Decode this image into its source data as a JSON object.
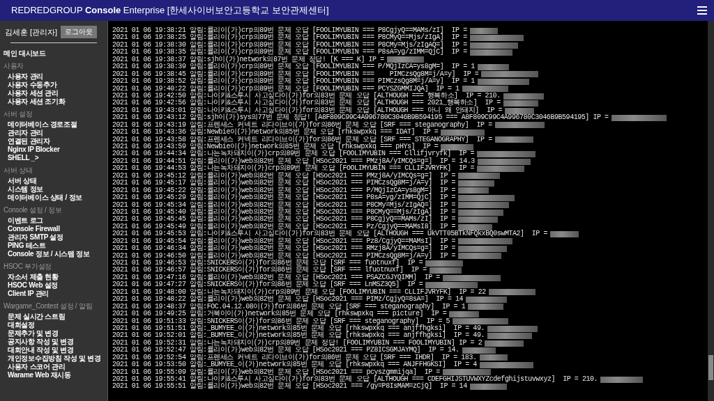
{
  "header": {
    "title": "REDREDGROUP **Console** Enterprise [한세사이버보안고등학교 보안관제센터]"
  },
  "sidebar": {
    "user": "김세훈 [관리자]",
    "logout": "로그아웃",
    "main_link": "메인 대시보드",
    "sections": [
      {
        "title": "사용자",
        "items": [
          "사용자 관리",
          "사용자 수동추가",
          "사용자 세션 관리",
          "사용자 세션 조기화"
        ]
      },
      {
        "title": "서버 설정",
        "items": [
          "데이터베이스 경로조절",
          "관리자 관리",
          "연결된 관리자",
          "Nginx IP Blocker",
          "SHELL _>"
        ]
      },
      {
        "title": "서버 상태",
        "items": [
          "서버 상태",
          "시스템 정보",
          "데이터베이스 상태 / 정보"
        ]
      },
      {
        "title": "Console 설정 / 정보",
        "items": [
          "이벤트 로그",
          "Console Firewall",
          "관리자 SMTP 설정",
          "PING 테스트",
          "Console 정보 / 시스템 정보"
        ]
      },
      {
        "title": "HSOC 부가설정",
        "items": [
          "자소서 제출 현황",
          "HSOC Web 설정",
          "Client IP 관리"
        ]
      },
      {
        "title": "Wargame_Contest 설정 / 알림",
        "items": [
          "문제 실시간 스트림",
          "대회설정",
          "문제추가 및 변경",
          "공지사항 작성 및 변경",
          "대회안내 작성 및 변경",
          "개인정보수집방침 작성 및 변경",
          "사용자 스코어 관리",
          "Warame Web 재시동"
        ]
      }
    ]
  },
  "log": {
    "lines": [
      "2021 01 06 19:38:21 알림:률리이(가)crp의89번 문제 오답 [FOOLIMYUBIN === P8CgjyQ==MAMs/zI]  IP =",
      "2021 01 06 19:38:25 알림:률리이(가)crp의89번 문제 오답 [FOOLIMYUBIN === P8CMyQ==Mjs/zIgA]  IP =",
      "2021 01 06 19:38:30 알림:률리이(가)crp의89번 문제 오답 [FOOLIMYUBIN === P8CMy=Mjs/zIgAQ=]  IP =",
      "2021 01 06 19:38:35 알림:률리이(가)crp의89번 문제 오답 [FOOLIMYUBIN === P8sA=yg/zIMM=QjC]  IP =",
      "2021 01 06 19:38:37 알림:sjh이(가)network의87번 문제 정답! [K === K] IP =",
      "2021 01 06 19:38:39 알림:률리이(가)crp의89번 문제 오답 [FOOLIMYUBIN === P/MQjIzCA=ys8gM=]  IP = 1",
      "2021 01 06 19:38:45 알림:률리이(가)crp의89번 문제 오답 [FOOLIMYUBIN ===    PIMCzsQg8M=j/A=y]  IP =",
      "2021 01 06 19:38:52 알림:률리이(가)crp의89번 문제 오답 [FOOLIMYUBIN === PIMCzsQg8M=j/A=y]  IP = 1",
      "2021 01 06 19:40:22 알림:률리이(가)crp의89번 문제 오답 [FOOLIMYUBIN === PCYSZGMMIJQA]  IP = 1",
      "2021 01 06 19:42:50 알림:나이키&스투시 사고싶다이(가)for의83번 문제 오답 [ALTHOUGH === 행복하소]  IP = 210.",
      "2021 01 06 19:42:56 알림:나이키&스투시 사고싶다이(가)for의83번 문제 오답 [ALTHOUGH === 2021_행복하소]  IP =",
      "2021 01 06 19:43:01 알림:나이키&스투시 사고싶다이(가)for의83번 문제 오답 [ALTHOUGH === 아니 왜 안돼지]  IP =",
      "2021 01 06 19:43:12 알림:sjh이(가)sys의77번 문제 정답! [A8F809C99C4A996780C3046B9B594195 === A8F809C99C4A996780C3046B9B594195] IP =",
      "2021 01 06 19:43:19 알림:프렌세스 커넥트 리다이브이(가)for의86번 문제 오답 [SRF === steganography]  IP =",
      "2021 01 06 19:43:36 알림:Newbie이(가)network의85번 문제 오답 [rhkswpxkq === IDAT]  IP =",
      "2021 01 06 19:43:58 알림:프렌세스 커넥트 리다이브이(가)for의86번 문제 오답 [SRF === STEGANOGRAPHY]  IP =",
      "2021 01 06 19:43:59 알림:Newbie이(가)network의85번 문제 오답 [rhkswpxkq === pHYs]  IP =",
      "2021 01 06 19:44:34 알림:나는녹차돼지이(가)crp의89번 문제 오답 [FOOLIMYUBIN === Cllifjvryfk]  IP =",
      "2021 01 06 19:44:51 알림:률리이(가)web의82번 문제 오답 [HSoc2021 === PMzj8A/yIMCQs=g=]  IP = 14.3",
      "2021 01 06 19:44:53 알림:나는녹차돼지이(가)crp의89번 문제 오답 [FOOLIMYUBIN === CLLIFJVRYFK]  IP =",
      "2021 01 06 19:45:12 알림:률리이(가)web의82번 문제 오답 [HSoc2021 === PMzj8A/yIMCQs=g=]  IP =",
      "2021 01 06 19:45:17 알림:률리이(가)web의82번 문제 오답 [HSoc2021 === PIMCzsQg8M=j/A=y]  IP =",
      "2021 01 06 19:45:22 알림:률리이(가)web의82번 문제 오답 [HSoc2021 === P/MQjIzCA=ys8gM=]  IP =",
      "2021 01 06 19:45:29 알림:률리이(가)web의82번 문제 오답 [HSoc2021 === P8sA=yg/zIMM=QjC]  IP =",
      "2021 01 06 19:45:34 알림:률리이(가)web의82번 문제 오답 [HSoc2021 === P8CMy=Mjs/zIgAQ=]  IP =",
      "2021 01 06 19:45:40 알림:률리이(가)web의82번 문제 오답 [HSoc2021 === P8CMyQ==Mjs/zIgA]  IP =",
      "2021 01 06 19:45:45 알림:률리이(가)web의82번 문제 오답 [HSoc2021 === P8CgjyQ==MAMs/zI]  IP =",
      "2021 01 06 19:45:49 알림:률리이(가)web의82번 문제 오답 [HSoc2021 === Pz/CgjyQ==MAMsI8]  IP =",
      "2021 01 06 19:45:53 알림:나이키&스투시 사고싶다이(가)for의83번 문제 오답 [ALTHOUGH === UkVTT05BTkNFQkxBQ0swMTA2]  IP =",
      "2021 01 06 19:45:54 알림:률리이(가)web의82번 문제 오답 [HSoc2021 === Pz8/CgjyQ==MAMsI]  IP =",
      "2021 01 06 19:46:34 알림:률리이(가)web의82번 문제 오답 [HSoc2021 === RMzj8A/yIMCQs=g=]  IP =",
      "2021 01 06 19:46:50 알림:률리이(가)web의82번 문제 오답 [HSoc2021 === PIMCzsQg8M=j/A=y]  IP =",
      "2021 01 06 19:46:53 알림:SNICKERS이(가)for의86번 문제 오답 [SRF === fuotnuxf]  IP =",
      "2021 01 06 19:46:57 알림:SNICKERS이(가)for의86번 문제 오답 [SRF === lfuotnuxf]  IP =",
      "2021 01 06 19:47:16 알림:률리이(가)web의82번 문제 오답 [HSoc2021 === PSAZCGJYQIMM]  IP =",
      "2021 01 06 19:47:27 알림:SNICKERS이(가)for의86번 문제 오답 [SRF === LnMSZ3Q5]  IP =",
      "2021 01 06 19:48:00 알림:나는녹차돼지이(가)crp의89번 문제 오답 [FOOLIMYUBIN === CLLIFJVRYFK]  IP = 22",
      "2021 01 06 19:48:22 알림:률리이(가)web의82번 문제 오답 [HSoc2021 === PIMz/CgjyQ=8sA=]  IP = 14",
      "2021 01 06 19:48:37 알림:FOC.04.12.08이(가)for의86번 문제 오답 [SRF === steganography]  IP = 1",
      "2021 01 06 19:49:25 알림:거북이이(가)network의85번 문제 오답 [rhkswpxkq === picture]  IP =",
      "2021 01 06 19:51:33 알림:SNICKERS이(가)for의86번 문제 오답 [SRF === steganography]  IP = 5",
      "2021 01 06 19:51:51 알림:_BUMYEE_이(가)network의85번 문제 오답 [rhkswpxkq === anjffhgksi]  IP = 49.",
      "2021 01 06 19:52:01 알림:_BUMYEE_이(가)network의85번 문제 오답 [rhkswpxkq === anjffhgksi]  IP = 49.",
      "2021 01 06 19:52:31 알림:나는녹차돼지이(가)crp의89번 문제 정답! [FOOLIMYUBIN === FOOLIMYUBIN] IP = 2",
      "2021 01 06 19:52:47 알림:률리이(가)web의82번 문제 오답 [HSoc2021 === PZ8ICSGMJAYMQ]  IP = 14.",
      "2021 01 06 19:52:54 알림:프렌세스 커넥트 리다이브이(가)for의86번 문제 오답 [SRF === IHDR]  IP = 183.",
      "2021 01 06 19:53:50 알림:_BUMYEE_이(가)network의85번 문제 오답 [rhkswpxkq === ANJFFHGKSI]  IP = 4",
      "2021 01 06 19:55:09 알림:률리이(가)web의82번 문제 오답 [HSoc2021 === pcyszgmmijqa]  IP =",
      "2021 01 06 19:55:41 알림:나이키&스투시 사고싶다이(가)for의83번 문제 오답 [ALTHOUGH === CDEFGHIJSTUVWXYZcdefghijstuvwxyz]  IP = 210.",
      "2021 01 06 19:55:51 알림:률리이(가)web의82번 문제 오답 [HSoc2021 === /gy=P8IsMAM=zCjQ]  IP = 14"
    ]
  }
}
